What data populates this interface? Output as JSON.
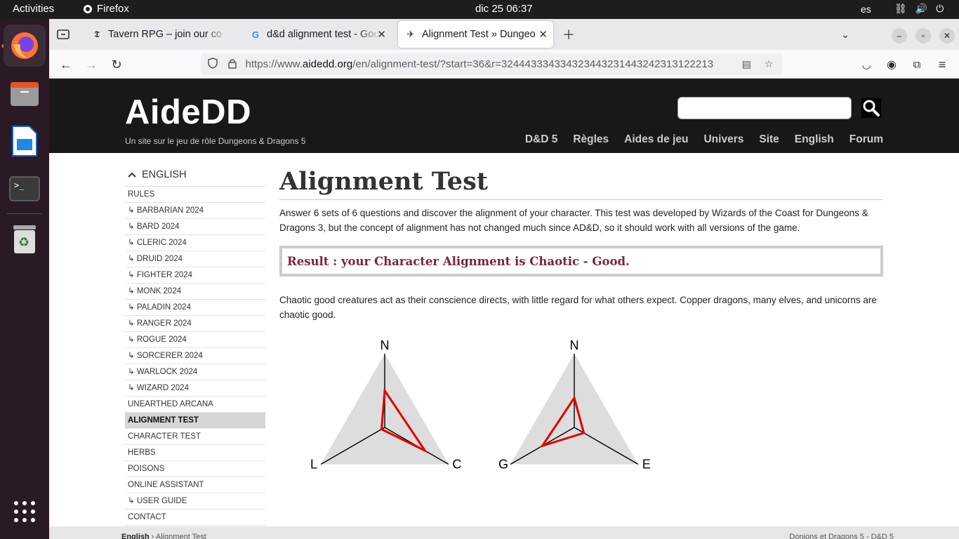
{
  "topbar": {
    "activities": "Activities",
    "app": "Firefox",
    "clock": "dic 25  06:37",
    "lang": "es"
  },
  "tabs": [
    {
      "label": "Tavern RPG – join our co",
      "icon": "tavern-favicon-icon"
    },
    {
      "label": "d&d alignment test - Goo",
      "icon": "google-favicon-icon"
    },
    {
      "label": "Alignment Test » Dungeo",
      "icon": "aidedd-favicon-icon"
    }
  ],
  "url": {
    "prefix": "https://www.",
    "domain": "aidedd.org",
    "path": "/en/alignment-test/?start=36&r=324443334334323443231443242313122213"
  },
  "site": {
    "logo": "AideDD",
    "tagline": "Un site sur le jeu de rôle Dungeons & Dragons 5",
    "nav": [
      "D&D 5",
      "Règles",
      "Aides de jeu",
      "Univers",
      "Site",
      "English",
      "Forum"
    ]
  },
  "sidebar": {
    "heading": "ENGLISH",
    "items": [
      "RULES",
      "↳ BARBARIAN 2024",
      "↳ BARD 2024",
      "↳ CLERIC 2024",
      "↳ DRUID 2024",
      "↳ FIGHTER 2024",
      "↳ MONK 2024",
      "↳ PALADIN 2024",
      "↳ RANGER 2024",
      "↳ ROGUE 2024",
      "↳ SORCERER 2024",
      "↳ WARLOCK 2024",
      "↳ WIZARD 2024",
      "UNEARTHED ARCANA",
      "ALIGNMENT TEST",
      "CHARACTER TEST",
      "HERBS",
      "POISONS",
      "ONLINE ASSISTANT",
      "↳ USER GUIDE",
      "CONTACT"
    ],
    "active": "ALIGNMENT TEST"
  },
  "main": {
    "title": "Alignment Test",
    "intro": "Answer 6 sets of 6 questions and discover the alignment of your character. This test was developed by Wizards of the Coast for Dungeons & Dragons 3, but the concept of alignment has not changed much since AD&D, so it should work with all versions of the game.",
    "result": "Result : your Character Alignment is Chaotic - Good.",
    "description": "Chaotic good creatures act as their conscience directs, with little regard for what others expect. Copper dragons, many elves, and unicorns are chaotic good."
  },
  "chart_data": [
    {
      "type": "radar",
      "axes": [
        "N",
        "L",
        "C"
      ],
      "values": [
        0.5,
        0.05,
        0.63
      ],
      "range": [
        0,
        1
      ],
      "series_color": "#e00000",
      "background_color": "#dddddd"
    },
    {
      "type": "radar",
      "axes": [
        "N",
        "G",
        "E"
      ],
      "values": [
        0.4,
        0.5,
        0.15
      ],
      "range": [
        0,
        1
      ],
      "series_color": "#e00000",
      "background_color": "#dddddd"
    }
  ],
  "footer": {
    "crumb_home": "English",
    "crumb_sep": " › ",
    "crumb_current": "Alignment Test",
    "right": "Donjons et Dragons 5 - D&D 5"
  }
}
